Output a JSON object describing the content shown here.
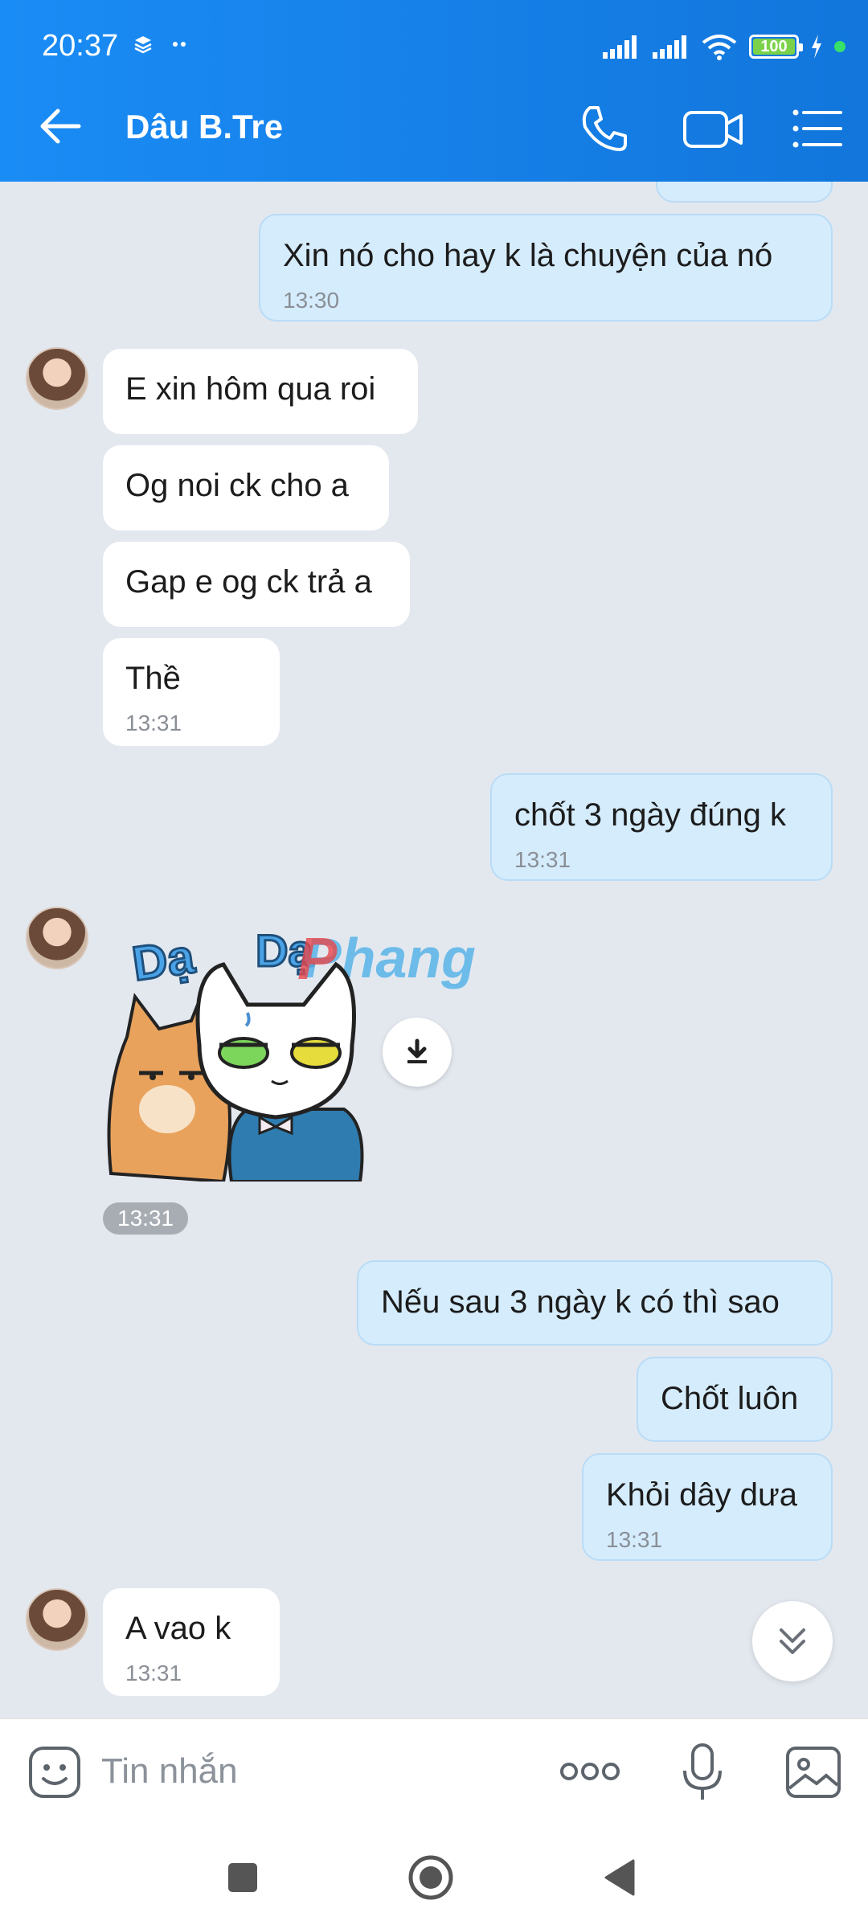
{
  "status_bar": {
    "time": "20:37",
    "battery": "100"
  },
  "header": {
    "title": "Dâu B.Tre"
  },
  "messages": [
    {
      "id": "m1",
      "text": "Xin nó cho hay k là chuyện của nó",
      "time": "13:30"
    },
    {
      "id": "m2",
      "text": "E xin hôm qua roi"
    },
    {
      "id": "m3",
      "text": "Og noi ck cho a"
    },
    {
      "id": "m4",
      "text": "Gap e og ck trả a"
    },
    {
      "id": "m5",
      "text": "Thề",
      "time": "13:31"
    },
    {
      "id": "m6",
      "text": "chốt 3 ngày đúng k",
      "time": "13:31"
    },
    {
      "id": "m7",
      "sticker_text": "Dạ Dạ",
      "sticker_brand": "Phang",
      "time": "13:31"
    },
    {
      "id": "m8",
      "text": "Nếu sau 3 ngày k có thì sao"
    },
    {
      "id": "m9",
      "text": "Chốt luôn"
    },
    {
      "id": "m10",
      "text": "Khỏi dây dưa",
      "time": "13:31"
    },
    {
      "id": "m11",
      "text": "A vao k",
      "time": "13:31"
    }
  ],
  "composer": {
    "placeholder": "Tin nhắn"
  },
  "colors": {
    "header": "#1a8cf5",
    "outgoing": "#d5ecfd",
    "incoming": "#ffffff",
    "background": "#e3e8ef"
  }
}
